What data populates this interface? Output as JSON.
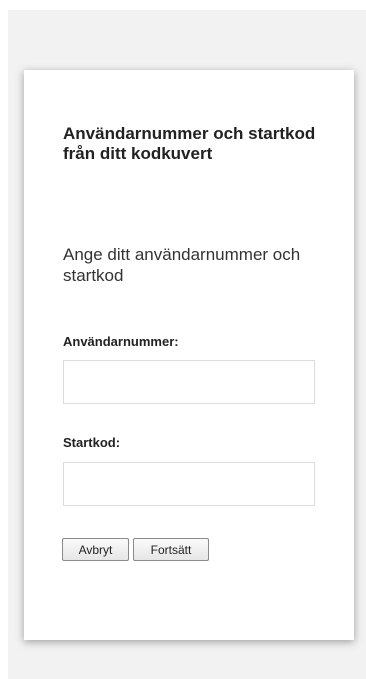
{
  "form": {
    "title": "Användarnummer och startkod från ditt kodkuvert",
    "instruction": "Ange ditt användarnummer och startkod",
    "user_number_label": "Användarnummer:",
    "user_number_value": "",
    "start_code_label": "Startkod:",
    "start_code_value": "",
    "cancel_label": "Avbryt",
    "continue_label": "Fortsätt"
  }
}
